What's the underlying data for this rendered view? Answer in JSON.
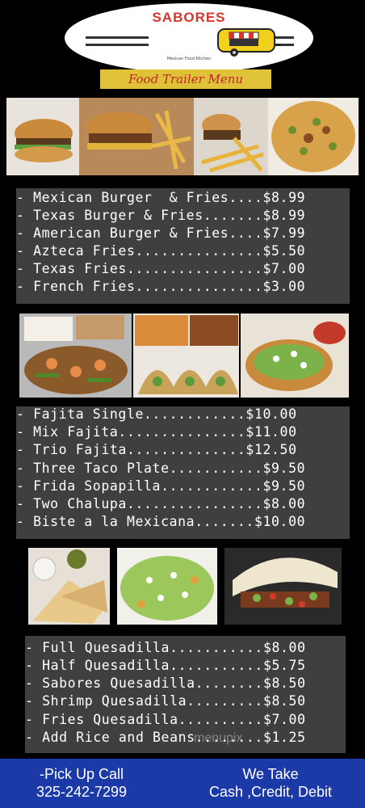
{
  "header": {
    "logo_name": "SABORES",
    "banner": "Food Trailer Menu",
    "tagline": "Mexican Food Kitchen"
  },
  "section1": {
    "items": [
      "- Mexican Burger  & Fries....$8.99",
      "- Texas Burger & Fries.......$8.99",
      "- American Burger & Fries....$7.99",
      "- Azteca Fries...............$5.50",
      "- Texas Fries................$7.00",
      "- French Fries...............$3.00"
    ]
  },
  "section2": {
    "items": [
      "- Fajita Single............$10.00",
      "- Mix Fajita...............$11.00",
      "- Trio Fajita..............$12.50",
      "- Three Taco Plate...........$9.50",
      "- Frida Sopapilla............$9.50",
      "- Two Chalupa................$8.00",
      "- Biste a la Mexicana.......$10.00"
    ]
  },
  "section3": {
    "items": [
      "- Full Quesadilla...........$8.00",
      "- Half Quesadilla...........$5.75",
      "- Sabores Quesadilla........$8.50",
      "- Shrimp Quesadilla.........$8.50",
      "- Fries Quesadilla..........$7.00",
      "- Add Rice and Beans........$1.25"
    ]
  },
  "footer": {
    "left_line1": "-Pick Up Call",
    "left_line2": "325-242-7299",
    "right_line1": "We Take",
    "right_line2": "Cash ,Credit, Debit"
  },
  "watermark": "menupix"
}
